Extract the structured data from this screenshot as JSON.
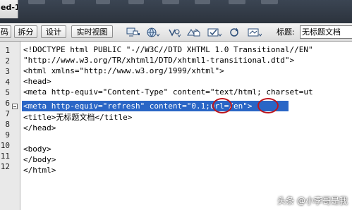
{
  "document_tab": {
    "label": "ed-1*"
  },
  "toolbar": {
    "view_buttons": [
      {
        "label": "码"
      },
      {
        "label": "拆分"
      },
      {
        "label": "设计"
      },
      {
        "label": "实时视图"
      }
    ],
    "icons": [
      "multiscreen-icon",
      "globe-icon",
      "debug-icon",
      "file-management-icon",
      "validate-icon",
      "refresh-icon",
      "visual-aids-icon"
    ],
    "title_label": "标题:",
    "title_value": "无标题文档"
  },
  "editor": {
    "line_numbers": [
      "1",
      "2",
      "3",
      "4",
      "5",
      "6",
      "7",
      "8",
      "9",
      "10",
      "11",
      "12"
    ],
    "lines": [
      "<!DOCTYPE html PUBLIC \"-//W3C//DTD XHTML 1.0 Transitional//EN\"",
      "\"http://www.w3.org/TR/xhtml1/DTD/xhtml1-transitional.dtd\">",
      "<html xmlns=\"http://www.w3.org/1999/xhtml\">",
      "<head>",
      "<meta http-equiv=\"Content-Type\" content=\"text/html; charset=ut",
      "<meta http-equiv=\"refresh\" content=\"0.1;url=/en\">",
      "<title>无标题文档</title>",
      "</head>",
      "",
      "<body>",
      "</body>",
      "</html>"
    ],
    "selected_line": "5"
  },
  "watermark": "头条 @小李哥是我",
  "colors": {
    "selection": "#2a66c6",
    "annotation": "#c0161c",
    "tabstrip": "#323a45"
  }
}
